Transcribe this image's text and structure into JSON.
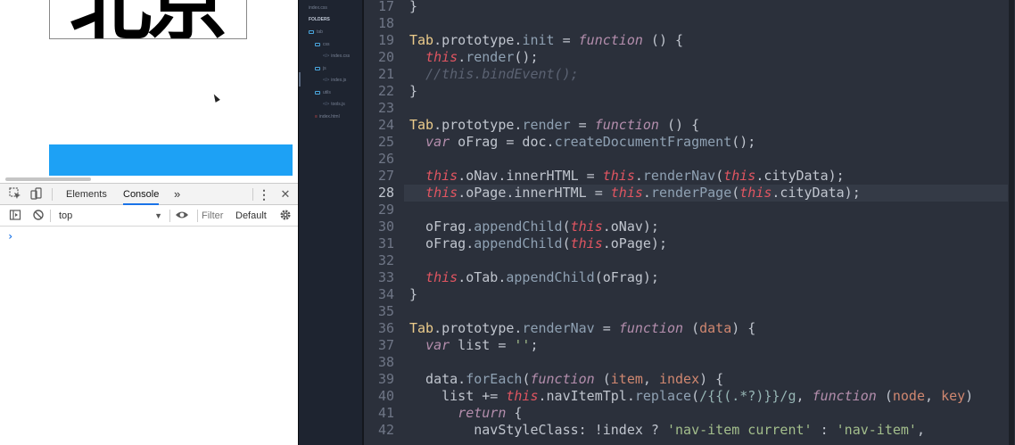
{
  "browser": {
    "preview": {
      "city_text": "北京"
    },
    "devtools": {
      "tabs": [
        "Elements",
        "Console"
      ],
      "more_tabs_glyph": "»",
      "menu_glyph": "⋮",
      "close_glyph": "✕",
      "console": {
        "context": "top",
        "filter_placeholder": "Filter",
        "levels": "Default",
        "prompt": "›"
      }
    }
  },
  "sidebar": {
    "open_file": "index.css",
    "folders_header": "FOLDERS",
    "tree": [
      {
        "kind": "folder",
        "label": "tab"
      },
      {
        "kind": "folder",
        "label": "css"
      },
      {
        "kind": "file",
        "label": "index.css"
      },
      {
        "kind": "folder",
        "label": "js"
      },
      {
        "kind": "file",
        "label": "index.js"
      },
      {
        "kind": "folder",
        "label": "utils"
      },
      {
        "kind": "file",
        "label": "tools.js"
      },
      {
        "kind": "file",
        "label": "index.html"
      }
    ]
  },
  "editor": {
    "current_line": 28,
    "lines": [
      {
        "n": 17,
        "t": [
          [
            "op",
            "}"
          ]
        ]
      },
      {
        "n": 18,
        "t": []
      },
      {
        "n": 19,
        "t": [
          [
            "cls",
            "Tab"
          ],
          [
            "op",
            "."
          ],
          [
            "proto",
            "prototype"
          ],
          [
            "op",
            "."
          ],
          [
            "fn",
            "init"
          ],
          [
            "op",
            " = "
          ],
          [
            "kw",
            "function"
          ],
          [
            "op",
            " () {"
          ]
        ]
      },
      {
        "n": 20,
        "t": [
          [
            "op",
            "  "
          ],
          [
            "this",
            "this"
          ],
          [
            "op",
            "."
          ],
          [
            "fn",
            "render"
          ],
          [
            "op",
            "();"
          ]
        ]
      },
      {
        "n": 21,
        "t": [
          [
            "op",
            "  "
          ],
          [
            "cmt",
            "//this.bindEvent();"
          ]
        ]
      },
      {
        "n": 22,
        "t": [
          [
            "op",
            "}"
          ]
        ]
      },
      {
        "n": 23,
        "t": []
      },
      {
        "n": 24,
        "t": [
          [
            "cls",
            "Tab"
          ],
          [
            "op",
            "."
          ],
          [
            "proto",
            "prototype"
          ],
          [
            "op",
            "."
          ],
          [
            "fn",
            "render"
          ],
          [
            "op",
            " = "
          ],
          [
            "kw",
            "function"
          ],
          [
            "op",
            " () {"
          ]
        ]
      },
      {
        "n": 25,
        "t": [
          [
            "op",
            "  "
          ],
          [
            "var",
            "var"
          ],
          [
            "op",
            " oFrag = doc."
          ],
          [
            "fn",
            "createDocumentFragment"
          ],
          [
            "op",
            "();"
          ]
        ]
      },
      {
        "n": 26,
        "t": []
      },
      {
        "n": 27,
        "t": [
          [
            "op",
            "  "
          ],
          [
            "this",
            "this"
          ],
          [
            "op",
            ".oNav.innerHTML = "
          ],
          [
            "this",
            "this"
          ],
          [
            "op",
            "."
          ],
          [
            "fn",
            "renderNav"
          ],
          [
            "op",
            "("
          ],
          [
            "this",
            "this"
          ],
          [
            "op",
            ".cityData);"
          ]
        ]
      },
      {
        "n": 28,
        "t": [
          [
            "op",
            "  "
          ],
          [
            "this",
            "this"
          ],
          [
            "op",
            ".oPage.innerHTML = "
          ],
          [
            "this",
            "this"
          ],
          [
            "op",
            "."
          ],
          [
            "fn",
            "renderPage"
          ],
          [
            "op",
            "("
          ],
          [
            "this",
            "this"
          ],
          [
            "op",
            ".cityData);"
          ]
        ]
      },
      {
        "n": 29,
        "t": []
      },
      {
        "n": 30,
        "t": [
          [
            "op",
            "  oFrag."
          ],
          [
            "fn",
            "appendChild"
          ],
          [
            "op",
            "("
          ],
          [
            "this",
            "this"
          ],
          [
            "op",
            ".oNav);"
          ]
        ]
      },
      {
        "n": 31,
        "t": [
          [
            "op",
            "  oFrag."
          ],
          [
            "fn",
            "appendChild"
          ],
          [
            "op",
            "("
          ],
          [
            "this",
            "this"
          ],
          [
            "op",
            ".oPage);"
          ]
        ]
      },
      {
        "n": 32,
        "t": []
      },
      {
        "n": 33,
        "t": [
          [
            "op",
            "  "
          ],
          [
            "this",
            "this"
          ],
          [
            "op",
            ".oTab."
          ],
          [
            "fn",
            "appendChild"
          ],
          [
            "op",
            "(oFrag);"
          ]
        ]
      },
      {
        "n": 34,
        "t": [
          [
            "op",
            "}"
          ]
        ]
      },
      {
        "n": 35,
        "t": []
      },
      {
        "n": 36,
        "t": [
          [
            "cls",
            "Tab"
          ],
          [
            "op",
            "."
          ],
          [
            "proto",
            "prototype"
          ],
          [
            "op",
            "."
          ],
          [
            "fn",
            "renderNav"
          ],
          [
            "op",
            " = "
          ],
          [
            "kw",
            "function"
          ],
          [
            "op",
            " ("
          ],
          [
            "param",
            "data"
          ],
          [
            "op",
            ") {"
          ]
        ]
      },
      {
        "n": 37,
        "t": [
          [
            "op",
            "  "
          ],
          [
            "var",
            "var"
          ],
          [
            "op",
            " list = "
          ],
          [
            "str",
            "''"
          ],
          [
            "op",
            ";"
          ]
        ]
      },
      {
        "n": 38,
        "t": []
      },
      {
        "n": 39,
        "t": [
          [
            "op",
            "  data."
          ],
          [
            "fn",
            "forEach"
          ],
          [
            "op",
            "("
          ],
          [
            "kw",
            "function"
          ],
          [
            "op",
            " ("
          ],
          [
            "param",
            "item"
          ],
          [
            "op",
            ", "
          ],
          [
            "param",
            "index"
          ],
          [
            "op",
            ") {"
          ]
        ]
      },
      {
        "n": 40,
        "t": [
          [
            "op",
            "    list += "
          ],
          [
            "this",
            "this"
          ],
          [
            "op",
            ".navItemTpl."
          ],
          [
            "fn",
            "replace"
          ],
          [
            "op",
            "("
          ],
          [
            "rx",
            "/{{(.*?)}}/g"
          ],
          [
            "op",
            ", "
          ],
          [
            "kw",
            "function"
          ],
          [
            "op",
            " ("
          ],
          [
            "param",
            "node"
          ],
          [
            "op",
            ", "
          ],
          [
            "param",
            "key"
          ],
          [
            "op",
            ")"
          ]
        ]
      },
      {
        "n": 41,
        "t": [
          [
            "op",
            "      "
          ],
          [
            "ret",
            "return"
          ],
          [
            "op",
            " {"
          ]
        ]
      },
      {
        "n": 42,
        "t": [
          [
            "op",
            "        navStyleClass: !index ? "
          ],
          [
            "str",
            "'nav-item current'"
          ],
          [
            "op",
            " : "
          ],
          [
            "str",
            "'nav-item'"
          ],
          [
            "op",
            ","
          ]
        ]
      }
    ]
  },
  "colors": {
    "editor_bg": "#2b303b",
    "sidebar_bg": "#1e2430",
    "accent_blue": "#1da1f5",
    "keyword": "#b48ead",
    "this_keyword": "#e05561",
    "class_name": "#ebcb8b",
    "function_name": "#8fa1b3",
    "string": "#a3be8c"
  }
}
